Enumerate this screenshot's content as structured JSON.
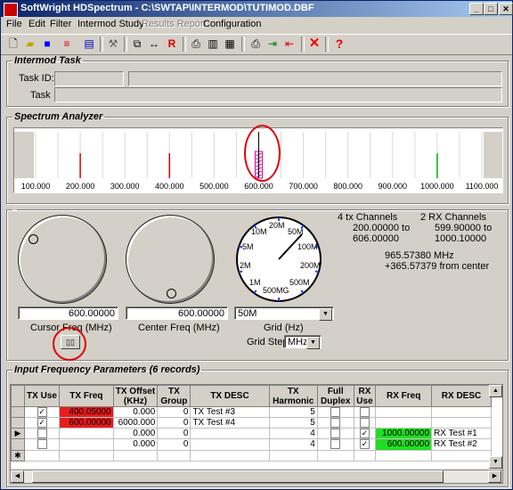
{
  "window": {
    "title": "SoftWright HDSpectrum - C:\\SWTAP\\INTERMOD\\TUTIMOD.DBF",
    "minimize": "_",
    "maximize": "□",
    "close": "✕"
  },
  "menu": {
    "file": "File",
    "edit": "Edit",
    "filter": "Filter",
    "intermod": "Intermod Study",
    "results": "Results Report",
    "config": "Configuration"
  },
  "toolbar": {
    "icons": [
      "new-icon",
      "open-icon",
      "save-icon",
      "list-icon",
      "grid-icon",
      "tool-icon",
      "select-icon",
      "range-icon",
      "r-icon",
      "print-icon",
      "doc-icon",
      "page-icon",
      "printer-icon",
      "export-icon",
      "import-icon",
      "delete-icon",
      "help-icon"
    ]
  },
  "task": {
    "legend": "Intermod Task",
    "id_label": "Task ID:",
    "task_label": "Task",
    "id_value": "",
    "desc_value": "",
    "task_value": ""
  },
  "spectrum": {
    "legend": "Spectrum Analyzer",
    "axis_labels": [
      "100.000",
      "200.000",
      "300.000",
      "400.000",
      "500.000",
      "600.000",
      "700.000",
      "800.000",
      "900.000",
      "1000.000",
      "1100.000"
    ],
    "axis_min": 100,
    "axis_max": 1100,
    "tx_lines": [
      200,
      400
    ],
    "rx_lines": [
      1000
    ],
    "cursor": 600,
    "tx_color": "#e00000",
    "rx_color": "#00b000"
  },
  "controls": {
    "cursor_freq": "600.00000",
    "cursor_label": "Cursor Freq (MHz)",
    "center_freq": "600.00000",
    "center_label": "Center Freq (MHz)",
    "grid_value": "50M",
    "grid_label": "Grid (Hz)",
    "grid_step_label": "Grid Step",
    "grid_step_value": "MHz",
    "dial_labels": [
      "20M",
      "50M",
      "100M",
      "200M",
      "500M",
      "500MG",
      "1M",
      "2M",
      "5M",
      "10M"
    ]
  },
  "info": {
    "tx_count": "4 tx Channels",
    "tx_range1": "200.00000 to",
    "tx_range2": "606.00000",
    "rx_count": "2 RX Channels",
    "rx_range1": "599.90000 to",
    "rx_range2": "1000.10000",
    "freq": "965.57380 MHz",
    "offset": "+365.57379 from center"
  },
  "params": {
    "legend": "Input Frequency Parameters (6 records)",
    "headers": [
      "TX Use",
      "TX Freq",
      "TX Offset (KHz)",
      "TX Group",
      "TX DESC",
      "TX Harmonic",
      "Full Duplex",
      "RX Use",
      "RX Freq",
      "RX DESC"
    ],
    "rows": [
      {
        "marker": "",
        "tx_use": "✓",
        "tx_freq": "400.05000",
        "tx_offset": "0.000",
        "tx_group": "0",
        "tx_desc": "TX Test #3",
        "harmonic": "5",
        "duplex": "",
        "rx_use": "",
        "rx_freq": "",
        "rx_desc": ""
      },
      {
        "marker": "",
        "tx_use": "✓",
        "tx_freq": "600.00000",
        "tx_offset": "6000.000",
        "tx_group": "0",
        "tx_desc": "TX Test #4",
        "harmonic": "5",
        "duplex": "",
        "rx_use": "",
        "rx_freq": "",
        "rx_desc": ""
      },
      {
        "marker": "▶",
        "tx_use": "",
        "tx_freq": "",
        "tx_offset": "0.000",
        "tx_group": "0",
        "tx_desc": "",
        "harmonic": "4",
        "duplex": "",
        "rx_use": "✓",
        "rx_freq": "1000.00000",
        "rx_desc": "RX Test #1"
      },
      {
        "marker": "",
        "tx_use": "",
        "tx_freq": "",
        "tx_offset": "0.000",
        "tx_group": "0",
        "tx_desc": "",
        "harmonic": "4",
        "duplex": "",
        "rx_use": "✓",
        "rx_freq": "600.00000",
        "rx_desc": "RX Test #2"
      },
      {
        "marker": "✱",
        "tx_use": "",
        "tx_freq": "",
        "tx_offset": "",
        "tx_group": "",
        "tx_desc": "",
        "harmonic": "",
        "duplex": "",
        "rx_use": "",
        "rx_freq": "",
        "rx_desc": ""
      }
    ]
  }
}
